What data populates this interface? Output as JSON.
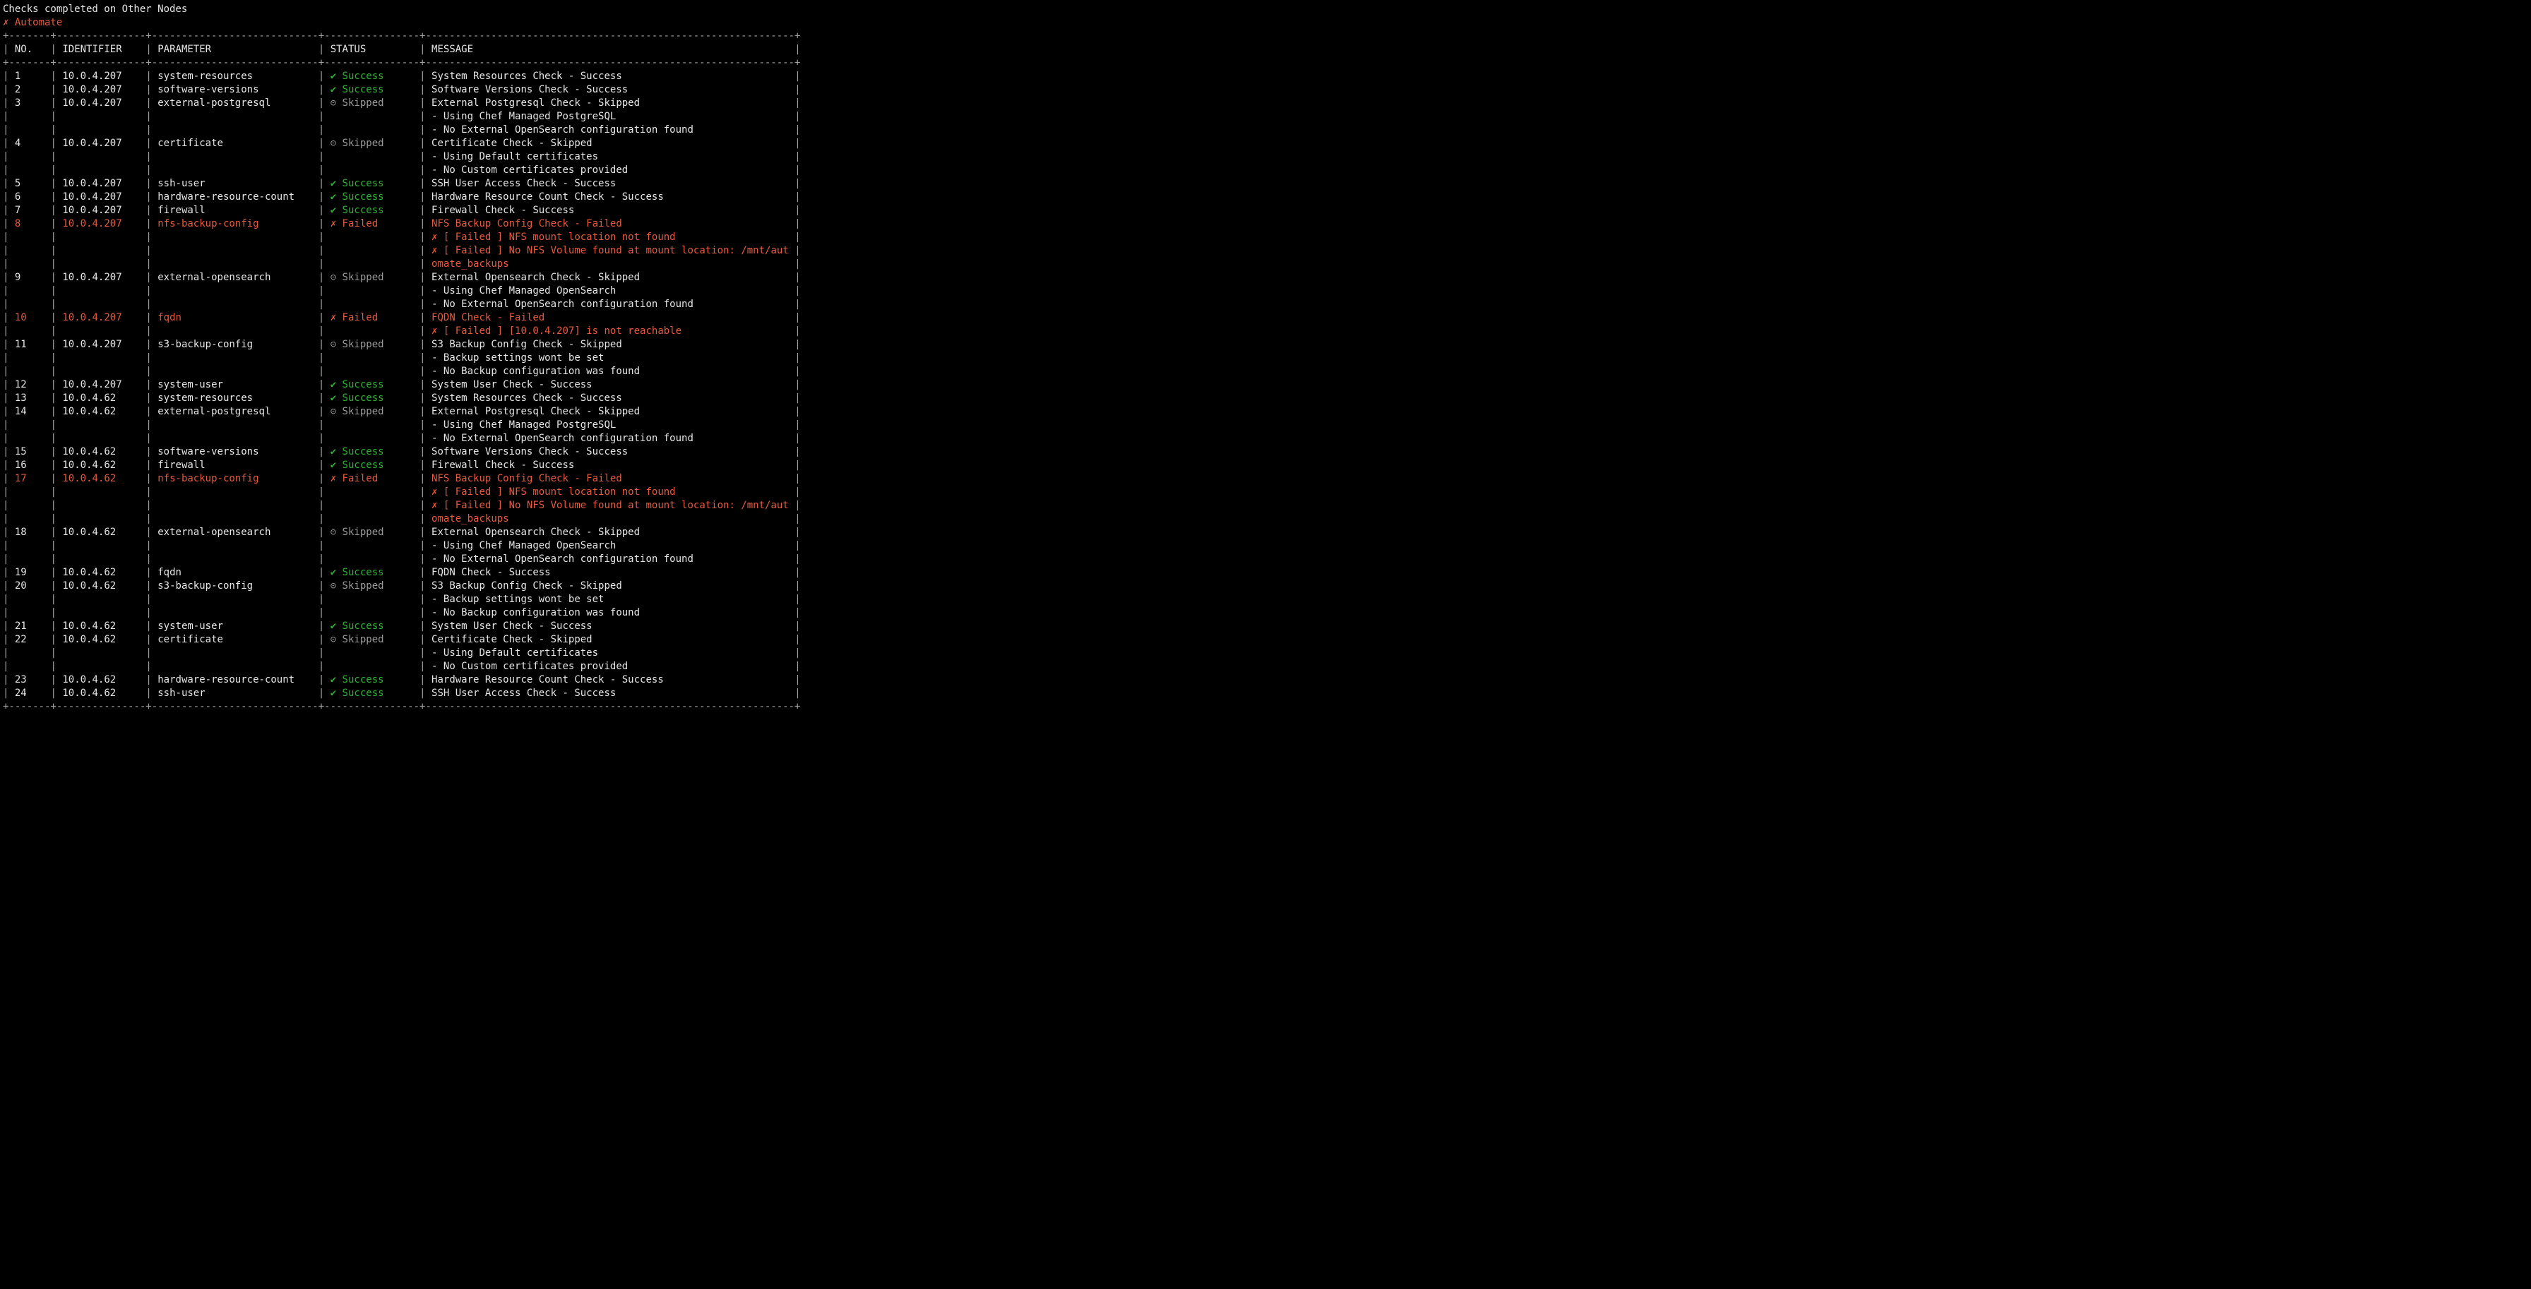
{
  "header": {
    "title": "Checks completed on Other Nodes",
    "subtitle": "Automate"
  },
  "columns": {
    "no": {
      "label": "NO.",
      "width": 5
    },
    "identifier": {
      "label": "IDENTIFIER",
      "width": 13
    },
    "parameter": {
      "label": "PARAMETER",
      "width": 26
    },
    "status": {
      "label": "STATUS",
      "width": 14
    },
    "message": {
      "label": "MESSAGE",
      "width": 60
    }
  },
  "status_labels": {
    "success": "Success",
    "failed": "Failed",
    "skipped": "Skipped"
  },
  "rows": [
    {
      "no": "1",
      "identifier": "10.0.4.207",
      "parameter": "system-resources",
      "status": "success",
      "messages": [
        "System Resources Check - Success"
      ]
    },
    {
      "no": "2",
      "identifier": "10.0.4.207",
      "parameter": "software-versions",
      "status": "success",
      "messages": [
        "Software Versions Check - Success"
      ]
    },
    {
      "no": "3",
      "identifier": "10.0.4.207",
      "parameter": "external-postgresql",
      "status": "skipped",
      "messages": [
        "External Postgresql Check - Skipped",
        "- Using Chef Managed PostgreSQL",
        "- No External OpenSearch configuration found"
      ]
    },
    {
      "no": "4",
      "identifier": "10.0.4.207",
      "parameter": "certificate",
      "status": "skipped",
      "messages": [
        "Certificate Check - Skipped",
        "- Using Default certificates",
        "- No Custom certificates provided"
      ]
    },
    {
      "no": "5",
      "identifier": "10.0.4.207",
      "parameter": "ssh-user",
      "status": "success",
      "messages": [
        "SSH User Access Check - Success"
      ]
    },
    {
      "no": "6",
      "identifier": "10.0.4.207",
      "parameter": "hardware-resource-count",
      "status": "success",
      "messages": [
        "Hardware Resource Count Check - Success"
      ]
    },
    {
      "no": "7",
      "identifier": "10.0.4.207",
      "parameter": "firewall",
      "status": "success",
      "messages": [
        "Firewall Check - Success"
      ]
    },
    {
      "no": "8",
      "identifier": "10.0.4.207",
      "parameter": "nfs-backup-config",
      "status": "failed",
      "messages": [
        "NFS Backup Config Check - Failed",
        "✗ [ Failed ] NFS mount location not found",
        "✗ [ Failed ] No NFS Volume found at mount location: /mnt/aut",
        "omate_backups"
      ]
    },
    {
      "no": "9",
      "identifier": "10.0.4.207",
      "parameter": "external-opensearch",
      "status": "skipped",
      "messages": [
        "External Opensearch Check - Skipped",
        "- Using Chef Managed OpenSearch",
        "- No External OpenSearch configuration found"
      ]
    },
    {
      "no": "10",
      "identifier": "10.0.4.207",
      "parameter": "fqdn",
      "status": "failed",
      "messages": [
        "FQDN Check - Failed",
        "✗ [ Failed ] [10.0.4.207] is not reachable"
      ]
    },
    {
      "no": "11",
      "identifier": "10.0.4.207",
      "parameter": "s3-backup-config",
      "status": "skipped",
      "messages": [
        "S3 Backup Config Check - Skipped",
        "- Backup settings wont be set",
        "- No Backup configuration was found"
      ]
    },
    {
      "no": "12",
      "identifier": "10.0.4.207",
      "parameter": "system-user",
      "status": "success",
      "messages": [
        "System User Check - Success"
      ]
    },
    {
      "no": "13",
      "identifier": "10.0.4.62",
      "parameter": "system-resources",
      "status": "success",
      "messages": [
        "System Resources Check - Success"
      ]
    },
    {
      "no": "14",
      "identifier": "10.0.4.62",
      "parameter": "external-postgresql",
      "status": "skipped",
      "messages": [
        "External Postgresql Check - Skipped",
        "- Using Chef Managed PostgreSQL",
        "- No External OpenSearch configuration found"
      ]
    },
    {
      "no": "15",
      "identifier": "10.0.4.62",
      "parameter": "software-versions",
      "status": "success",
      "messages": [
        "Software Versions Check - Success"
      ]
    },
    {
      "no": "16",
      "identifier": "10.0.4.62",
      "parameter": "firewall",
      "status": "success",
      "messages": [
        "Firewall Check - Success"
      ]
    },
    {
      "no": "17",
      "identifier": "10.0.4.62",
      "parameter": "nfs-backup-config",
      "status": "failed",
      "messages": [
        "NFS Backup Config Check - Failed",
        "✗ [ Failed ] NFS mount location not found",
        "✗ [ Failed ] No NFS Volume found at mount location: /mnt/aut",
        "omate_backups"
      ]
    },
    {
      "no": "18",
      "identifier": "10.0.4.62",
      "parameter": "external-opensearch",
      "status": "skipped",
      "messages": [
        "External Opensearch Check - Skipped",
        "- Using Chef Managed OpenSearch",
        "- No External OpenSearch configuration found"
      ]
    },
    {
      "no": "19",
      "identifier": "10.0.4.62",
      "parameter": "fqdn",
      "status": "success",
      "messages": [
        "FQDN Check - Success"
      ]
    },
    {
      "no": "20",
      "identifier": "10.0.4.62",
      "parameter": "s3-backup-config",
      "status": "skipped",
      "messages": [
        "S3 Backup Config Check - Skipped",
        "- Backup settings wont be set",
        "- No Backup configuration was found"
      ]
    },
    {
      "no": "21",
      "identifier": "10.0.4.62",
      "parameter": "system-user",
      "status": "success",
      "messages": [
        "System User Check - Success"
      ]
    },
    {
      "no": "22",
      "identifier": "10.0.4.62",
      "parameter": "certificate",
      "status": "skipped",
      "messages": [
        "Certificate Check - Skipped",
        "- Using Default certificates",
        "- No Custom certificates provided"
      ]
    },
    {
      "no": "23",
      "identifier": "10.0.4.62",
      "parameter": "hardware-resource-count",
      "status": "success",
      "messages": [
        "Hardware Resource Count Check - Success"
      ]
    },
    {
      "no": "24",
      "identifier": "10.0.4.62",
      "parameter": "ssh-user",
      "status": "success",
      "messages": [
        "SSH User Access Check - Success"
      ]
    }
  ]
}
